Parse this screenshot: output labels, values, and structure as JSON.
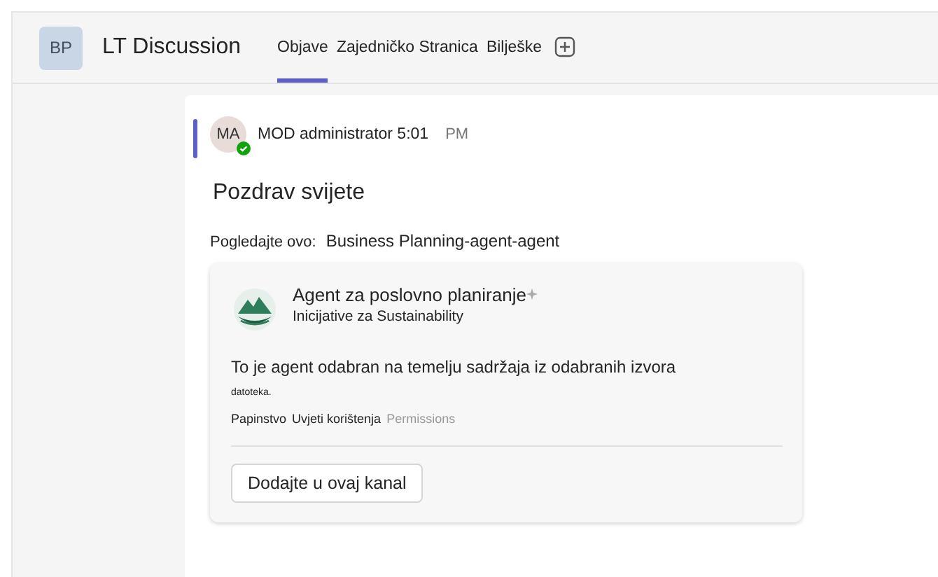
{
  "team": {
    "initials": "BP",
    "name": "LT Discussion"
  },
  "tabs": [
    {
      "label": "Objave",
      "selected": true
    },
    {
      "label": "Zajedničko Stranica",
      "selected": false
    },
    {
      "label": "Bilješke",
      "selected": false
    }
  ],
  "post": {
    "initials": "MA",
    "available": true,
    "author": "MOD administrator 5:01",
    "time": "PM",
    "subject": "Pozdrav svijete",
    "prompt": "Pogledajte ovo:",
    "mention": "Business Planning-agent-agent",
    "card": {
      "title": "Agent za poslovno planiranje",
      "subtitle": "Inicijative za Sustainability",
      "description": "To je agent odabran na temelju sadržaja iz odabranih izvora",
      "note": "datoteka.",
      "links": [
        {
          "label": "Papinstvo",
          "disabled": false
        },
        {
          "label": "Uvjeti korištenja",
          "disabled": false
        },
        {
          "label": "Permissions",
          "disabled": true
        }
      ],
      "button": "Dodajte u ovaj kanal"
    }
  }
}
